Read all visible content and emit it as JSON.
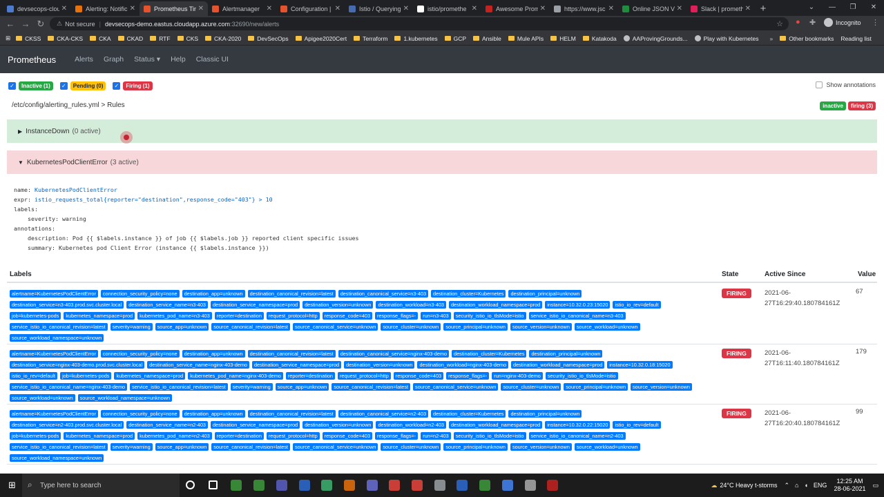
{
  "browser": {
    "tabs": [
      {
        "title": "devsecops-clou",
        "color": "#4a7bd0"
      },
      {
        "title": "Alerting: Notific",
        "color": "#e8710a"
      },
      {
        "title": "Prometheus Tin",
        "color": "#e6522c",
        "active": true
      },
      {
        "title": "Alertmanager",
        "color": "#e6522c"
      },
      {
        "title": "Configuration |",
        "color": "#e6522c"
      },
      {
        "title": "Istio / Querying",
        "color": "#466bb0"
      },
      {
        "title": "istio/promethe",
        "color": "#ffffff"
      },
      {
        "title": "Awesome Prom",
        "color": "#c5221f"
      },
      {
        "title": "https://www.jsc",
        "color": "#9aa0a6"
      },
      {
        "title": "Online JSON Vie",
        "color": "#1e8e3e"
      },
      {
        "title": "Slack | prometh",
        "color": "#e01e5a"
      }
    ],
    "url_warning": "Not secure",
    "url_host": "devsecops-demo.eastus.cloudapp.azure.com",
    "url_path": ":32690/new/alerts",
    "profile": "Incognito",
    "bookmarks": [
      "CKSS",
      "CKA-CKS",
      "CKA",
      "CKAD",
      "RTF",
      "CKS",
      "CKA-2020",
      "DevSecOps",
      "Apigee2020Cert",
      "Terraform",
      "1.kubernetes",
      "GCP",
      "Ansible",
      "Mule APIs",
      "HELM",
      "Katakoda",
      "AAProvingGrounds...",
      "Play with Kubernetes"
    ],
    "other_bookmarks": "Other bookmarks",
    "reading_list": "Reading list"
  },
  "nav": {
    "brand": "Prometheus",
    "links": [
      "Alerts",
      "Graph",
      "Status ▾",
      "Help",
      "Classic UI"
    ]
  },
  "filters": {
    "inactive": "Inactive (1)",
    "pending": "Pending (0)",
    "firing": "Firing (1)",
    "show_annotations": "Show annotations"
  },
  "rulefile": {
    "path": "/etc/config/alerting_rules.yml > Rules",
    "badge_inactive": "inactive",
    "badge_firing": "firing (3)"
  },
  "groups": [
    {
      "name": "InstanceDown",
      "count": "(0 active)"
    },
    {
      "name": "KubernetesPodClientError",
      "count": "(3 active)"
    }
  ],
  "rule": {
    "name_key": "name:",
    "name_val": "KubernetesPodClientError",
    "expr_key": "expr:",
    "expr_val": "istio_requests_total{reporter=\"destination\",response_code=\"403\"} > 10",
    "labels_key": "labels:",
    "severity": "  severity: warning",
    "annotations_key": "annotations:",
    "description": "  description: Pod {{ $labels.instance }} of job {{ $labels.job }} reported client specific issues",
    "summary": "  summary: Kubernetes pod Client Error (instance {{ $labels.instance }})"
  },
  "table": {
    "headers": {
      "labels": "Labels",
      "state": "State",
      "since": "Active Since",
      "value": "Value"
    },
    "rows": [
      {
        "labels": [
          "alertname=KubernetesPodClientError",
          "connection_security_policy=none",
          "destination_app=unknown",
          "destination_canonical_revision=latest",
          "destination_canonical_service=n3-403",
          "destination_cluster=Kubernetes",
          "destination_principal=unknown",
          "destination_service=n3-403.prod.svc.cluster.local",
          "destination_service_name=n3-403",
          "destination_service_namespace=prod",
          "destination_version=unknown",
          "destination_workload=n3-403",
          "destination_workload_namespace=prod",
          "instance=10.32.0.23:15020",
          "istio_io_rev=default",
          "job=kubernetes-pods",
          "kubernetes_namespace=prod",
          "kubernetes_pod_name=n3-403",
          "reporter=destination",
          "request_protocol=http",
          "response_code=403",
          "response_flags=-",
          "run=n3-403",
          "security_istio_io_tlsMode=istio",
          "service_istio_io_canonical_name=n3-403",
          "service_istio_io_canonical_revision=latest",
          "severity=warning",
          "source_app=unknown",
          "source_canonical_revision=latest",
          "source_canonical_service=unknown",
          "source_cluster=unknown",
          "source_principal=unknown",
          "source_version=unknown",
          "source_workload=unknown",
          "source_workload_namespace=unknown"
        ],
        "state": "FIRING",
        "since": "2021-06-27T16:29:40.180784161Z",
        "value": "67"
      },
      {
        "labels": [
          "alertname=KubernetesPodClientError",
          "connection_security_policy=none",
          "destination_app=unknown",
          "destination_canonical_revision=latest",
          "destination_canonical_service=nginx-403-demo",
          "destination_cluster=Kubernetes",
          "destination_principal=unknown",
          "destination_service=nginx-403-demo.prod.svc.cluster.local",
          "destination_service_name=nginx-403-demo",
          "destination_service_namespace=prod",
          "destination_version=unknown",
          "destination_workload=nginx-403-demo",
          "destination_workload_namespace=prod",
          "instance=10.32.0.18:15020",
          "istio_io_rev=default",
          "job=kubernetes-pods",
          "kubernetes_namespace=prod",
          "kubernetes_pod_name=nginx-403-demo",
          "reporter=destination",
          "request_protocol=http",
          "response_code=403",
          "response_flags=-",
          "run=nginx-403-demo",
          "security_istio_io_tlsMode=istio",
          "service_istio_io_canonical_name=nginx-403-demo",
          "service_istio_io_canonical_revision=latest",
          "severity=warning",
          "source_app=unknown",
          "source_canonical_revision=latest",
          "source_canonical_service=unknown",
          "source_cluster=unknown",
          "source_principal=unknown",
          "source_version=unknown",
          "source_workload=unknown",
          "source_workload_namespace=unknown"
        ],
        "state": "FIRING",
        "since": "2021-06-27T16:11:40.180784161Z",
        "value": "179"
      },
      {
        "labels": [
          "alertname=KubernetesPodClientError",
          "connection_security_policy=none",
          "destination_app=unknown",
          "destination_canonical_revision=latest",
          "destination_canonical_service=n2-403",
          "destination_cluster=Kubernetes",
          "destination_principal=unknown",
          "destination_service=n2-403.prod.svc.cluster.local",
          "destination_service_name=n2-403",
          "destination_service_namespace=prod",
          "destination_version=unknown",
          "destination_workload=n2-403",
          "destination_workload_namespace=prod",
          "instance=10.32.0.22:15020",
          "istio_io_rev=default",
          "job=kubernetes-pods",
          "kubernetes_namespace=prod",
          "kubernetes_pod_name=n2-403",
          "reporter=destination",
          "request_protocol=http",
          "response_code=403",
          "response_flags=-",
          "run=n2-403",
          "security_istio_io_tlsMode=istio",
          "service_istio_io_canonical_name=n2-403",
          "service_istio_io_canonical_revision=latest",
          "severity=warning",
          "source_app=unknown",
          "source_canonical_revision=latest",
          "source_canonical_service=unknown",
          "source_cluster=unknown",
          "source_principal=unknown",
          "source_version=unknown",
          "source_workload=unknown",
          "source_workload_namespace=unknown"
        ],
        "state": "FIRING",
        "since": "2021-06-27T16:20:40.180784161Z",
        "value": "99"
      }
    ]
  },
  "taskbar": {
    "search_placeholder": "Type here to search",
    "weather": "24°C  Heavy t-storms",
    "lang": "ENG",
    "time": "12:25 AM",
    "date": "28-06-2021"
  }
}
